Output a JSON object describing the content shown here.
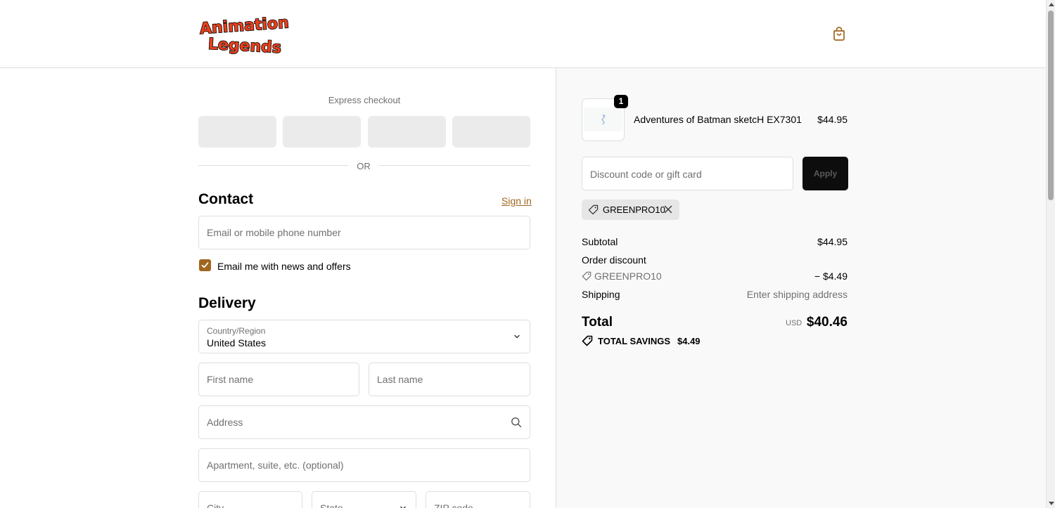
{
  "brand": {
    "logo_alt": "Animation Legends",
    "logo_line1": "Animation",
    "logo_line2": "Legends"
  },
  "header": {
    "cart_icon": "shopping-bag-icon"
  },
  "express": {
    "title": "Express checkout",
    "or_text": "OR"
  },
  "contact": {
    "heading": "Contact",
    "sign_in": "Sign in",
    "email_placeholder": "Email or mobile phone number",
    "newsletter_label": "Email me with news and offers",
    "newsletter_checked": true
  },
  "delivery": {
    "heading": "Delivery",
    "country_label": "Country/Region",
    "country_value": "United States",
    "first_name": "First name",
    "last_name": "Last name",
    "address": "Address",
    "apartment": "Apartment, suite, etc. (optional)",
    "city": "City",
    "state": "State",
    "zip": "ZIP code"
  },
  "cart": {
    "item": {
      "quantity": "1",
      "name": "Adventures of Batman sketcH EX7301",
      "price": "$44.95"
    },
    "discount_placeholder": "Discount code or gift card",
    "apply_label": "Apply",
    "applied_code": "GREENPRO10"
  },
  "summary": {
    "subtotal_label": "Subtotal",
    "subtotal_value": "$44.95",
    "order_discount_label": "Order discount",
    "discount_code": "GREENPRO10",
    "discount_value": "− $4.49",
    "shipping_label": "Shipping",
    "shipping_value": "Enter shipping address",
    "total_label": "Total",
    "currency": "USD",
    "total_value": "$40.46",
    "savings_label": "TOTAL SAVINGS",
    "savings_value": "$4.49"
  },
  "colors": {
    "accent": "#a0661f",
    "logo_red": "#e8401c",
    "button_dark": "#0d0d0d",
    "panel_bg": "#f9f9f9"
  }
}
